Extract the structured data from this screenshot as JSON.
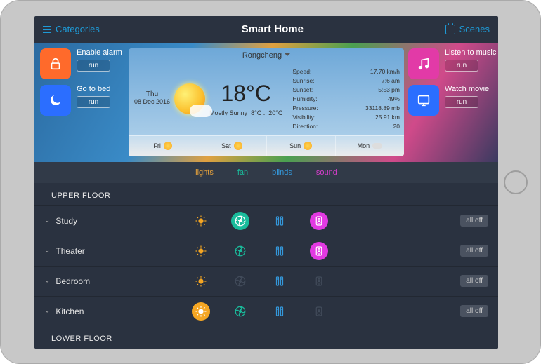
{
  "topbar": {
    "left": "Categories",
    "title": "Smart Home",
    "right": "Scenes"
  },
  "scenes_left": [
    {
      "name": "Enable alarm",
      "run": "run",
      "color": "#ff6a2b",
      "icon": "lock"
    },
    {
      "name": "Go to bed",
      "run": "run",
      "color": "#2b6eff",
      "icon": "moon"
    }
  ],
  "scenes_right": [
    {
      "name": "Listen to music",
      "run": "run",
      "color": "#e23aa7",
      "icon": "music"
    },
    {
      "name": "Watch movie",
      "run": "run",
      "color": "#2b6eff",
      "icon": "screen"
    }
  ],
  "weather": {
    "location": "Rongcheng",
    "day": "Thu",
    "date": "08 Dec 2016",
    "temp": "18°C",
    "condition": "Mostly Sunny",
    "range": "8°C .. 20°C",
    "stats": [
      {
        "k": "Speed:",
        "v": "17.70 km/h"
      },
      {
        "k": "Sunrise:",
        "v": "7:6 am"
      },
      {
        "k": "Sunset:",
        "v": "5:53 pm"
      },
      {
        "k": "Humidity:",
        "v": "49%"
      },
      {
        "k": "Pressure:",
        "v": "33118.89 mb"
      },
      {
        "k": "Visibility:",
        "v": "25.91 km"
      },
      {
        "k": "Direction:",
        "v": "20"
      }
    ],
    "forecast": [
      {
        "d": "Fri",
        "ic": "sun"
      },
      {
        "d": "Sat",
        "ic": "sun"
      },
      {
        "d": "Sun",
        "ic": "sun"
      },
      {
        "d": "Mon",
        "ic": "cloud"
      }
    ]
  },
  "categories": [
    "lights",
    "fan",
    "blinds",
    "sound"
  ],
  "sections": [
    {
      "title": "UPPER FLOOR",
      "rooms": [
        {
          "name": "Study",
          "off": "all off",
          "devices": [
            {
              "type": "lights",
              "state": "dim"
            },
            {
              "type": "fan",
              "state": "on"
            },
            {
              "type": "blinds",
              "state": "dim"
            },
            {
              "type": "sound",
              "state": "on"
            }
          ]
        },
        {
          "name": "Theater",
          "off": "all off",
          "devices": [
            {
              "type": "lights",
              "state": "dim"
            },
            {
              "type": "fan",
              "state": "dim"
            },
            {
              "type": "blinds",
              "state": "dim"
            },
            {
              "type": "sound",
              "state": "on"
            }
          ]
        },
        {
          "name": "Bedroom",
          "off": "all off",
          "devices": [
            {
              "type": "lights",
              "state": "dim"
            },
            {
              "type": "fan",
              "state": "off"
            },
            {
              "type": "blinds",
              "state": "dim"
            },
            {
              "type": "sound",
              "state": "off"
            }
          ]
        },
        {
          "name": "Kitchen",
          "off": "all off",
          "devices": [
            {
              "type": "lights",
              "state": "on"
            },
            {
              "type": "fan",
              "state": "dim"
            },
            {
              "type": "blinds",
              "state": "dim"
            },
            {
              "type": "sound",
              "state": "off"
            }
          ]
        }
      ]
    },
    {
      "title": "LOWER FLOOR",
      "rooms": []
    }
  ],
  "colors": {
    "lights": "#f5a623",
    "fan": "#1abc9c",
    "blinds": "#3498db",
    "sound": "#e23ae2"
  }
}
